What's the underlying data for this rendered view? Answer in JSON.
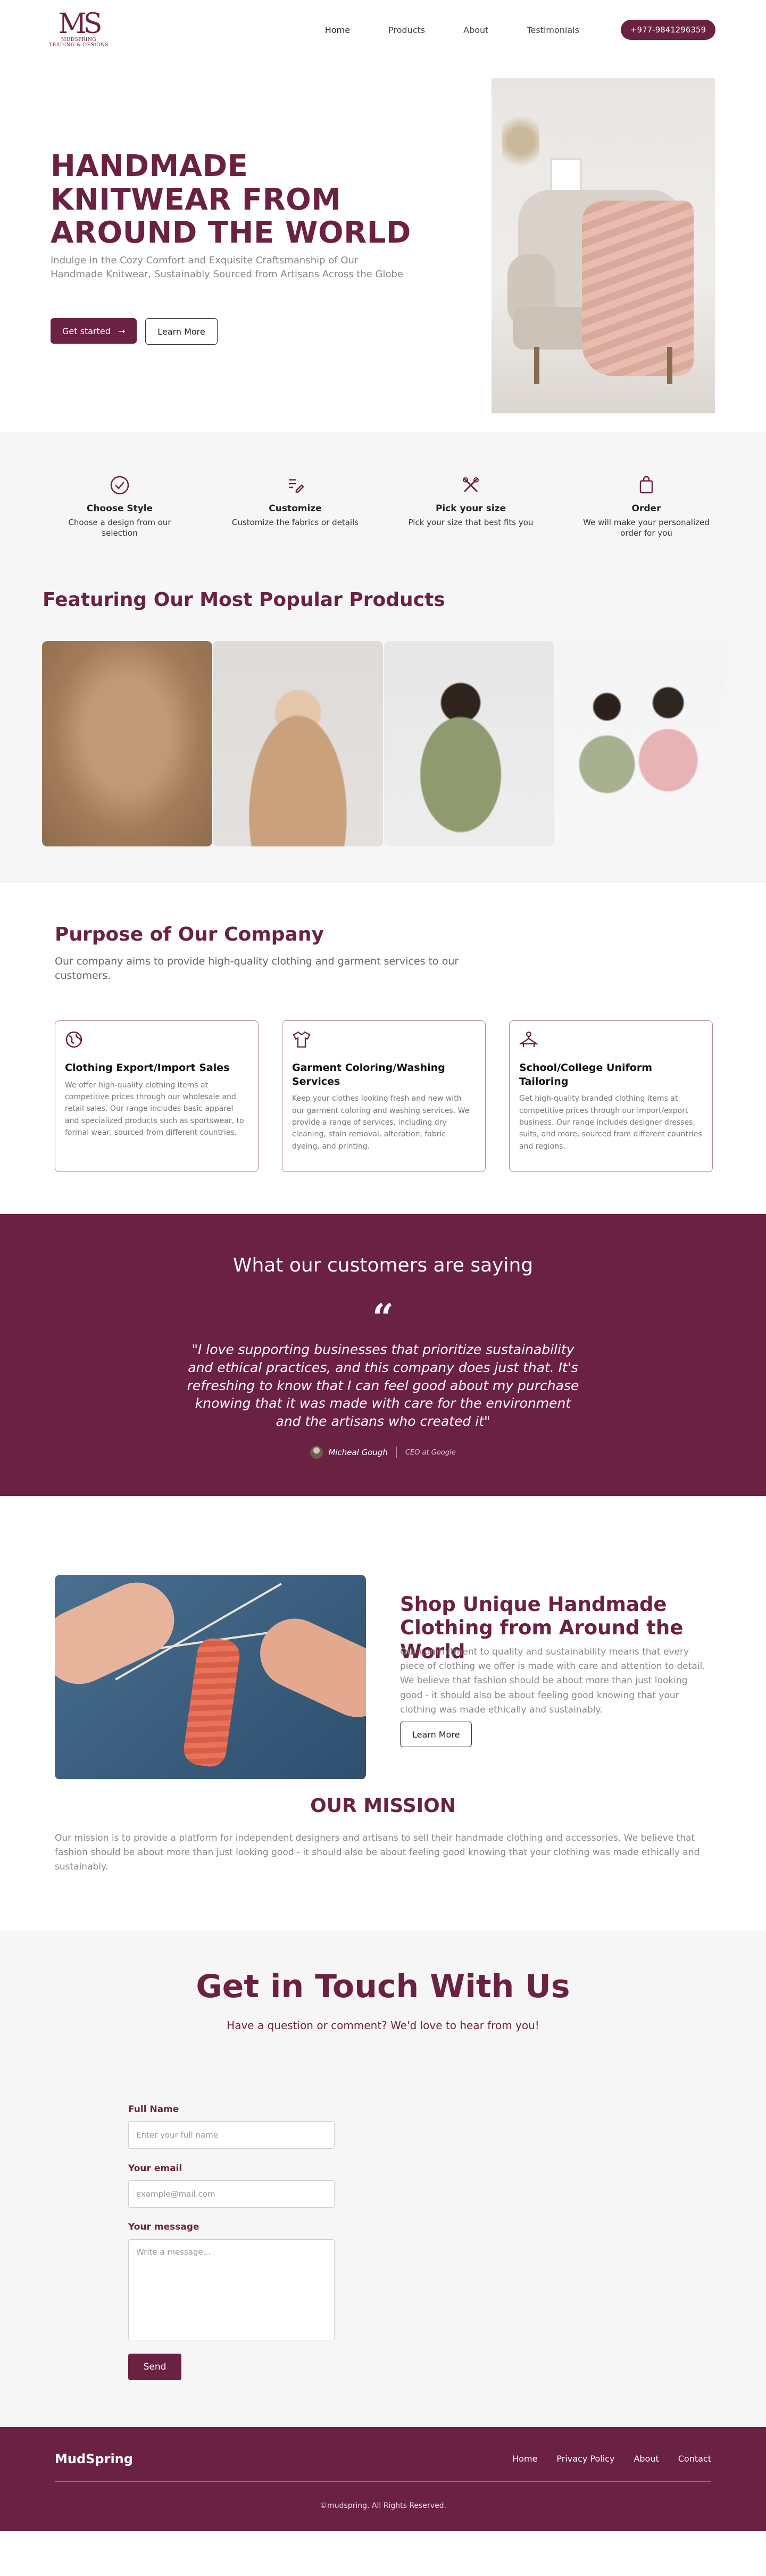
{
  "brand": {
    "logo_mark": "MS",
    "logo_line1": "MUDSPRING",
    "logo_line2": "TRADING & DESIGNS"
  },
  "nav": {
    "links": [
      "Home",
      "Products",
      "About",
      "Testimonials"
    ],
    "phone": "+977-9841296359"
  },
  "hero": {
    "title_line1": "HANDMADE",
    "title_line2": "KNITWEAR FROM",
    "title_line3": "AROUND THE WORLD",
    "subtitle": "Indulge in the Cozy Comfort and Exquisite Craftsmanship of Our Handmade Knitwear, Sustainably Sourced from Artisans Across the Globe",
    "primary_button": "Get started",
    "secondary_button": "Learn More"
  },
  "steps": [
    {
      "icon": "check-circle-icon",
      "title": "Choose Style",
      "desc": "Choose a design from our selection"
    },
    {
      "icon": "edit-icon",
      "title": "Customize",
      "desc": "Customize the fabrics or details"
    },
    {
      "icon": "tools-icon",
      "title": "Pick your size",
      "desc": "Pick your size that best fits you"
    },
    {
      "icon": "shopping-bag-icon",
      "title": "Order",
      "desc": "We will make your personalized order for you"
    }
  ],
  "products": {
    "heading": "Featuring Our Most Popular Products"
  },
  "purpose": {
    "heading": "Purpose of Our Company",
    "subtitle": "Our company aims to provide high-quality clothing and garment services to our customers.",
    "cards": [
      {
        "icon": "globe-icon",
        "title": "Clothing Export/Import Sales",
        "body": "We offer high-quality clothing items at competitive prices through our wholesale and retail sales. Our range includes basic apparel and specialized products such as sportswear, to formal wear, sourced from different countries."
      },
      {
        "icon": "shirt-icon",
        "title": "Garment Coloring/Washing Services",
        "body": "Keep your clothes looking fresh and new with our garment coloring and washing services. We provide a range of services, including dry cleaning, stain removal, alteration, fabric dyeing, and printing."
      },
      {
        "icon": "hanger-icon",
        "title": "School/College Uniform Tailoring",
        "body": "Get high-quality branded clothing items at competitive prices through our import/export business. Our range includes designer dresses, suits, and more, sourced from different countries and regions."
      }
    ]
  },
  "testimonial": {
    "heading": "What our customers are saying",
    "quote": "\"I love supporting businesses that prioritize sustainability and ethical practices, and this company does just that. It's refreshing to know that I can feel good about my purchase knowing that it was made with care for the environment and the artisans who created it\"",
    "author_name": "Micheal Gough",
    "author_role": "CEO at Google"
  },
  "shop": {
    "heading": "Shop Unique Handmade Clothing from Around the World",
    "body": "Our commitment to quality and sustainability means that every piece of clothing we offer is made with care and attention to detail. We believe that fashion should be about more than just looking good - it should also be about feeling good knowing that your clothing was made ethically and sustainably.",
    "button": "Learn More"
  },
  "mission": {
    "heading": "OUR MISSION",
    "body": "Our mission is to provide a platform for independent designers and artisans to sell their handmade clothing and accessories. We believe that fashion should be about more than just looking good - it should also be about feeling good knowing that your clothing was made ethically and sustainably."
  },
  "contact": {
    "heading": "Get in Touch With Us",
    "subtitle": "Have a question or comment? We'd love to hear from you!",
    "name_label": "Full Name",
    "name_placeholder": "Enter your full name",
    "email_label": "Your email",
    "email_placeholder": "example@mail.com",
    "message_label": "Your message",
    "message_placeholder": "Write a message...",
    "send_button": "Send"
  },
  "footer": {
    "brand": "MudSpring",
    "links": [
      "Home",
      "Privacy Policy",
      "About",
      "Contact"
    ],
    "copyright": "©mudspring. All Rights Reserved."
  },
  "colors": {
    "brand": "#6b2242",
    "muted_bg": "#f6f6f6"
  }
}
